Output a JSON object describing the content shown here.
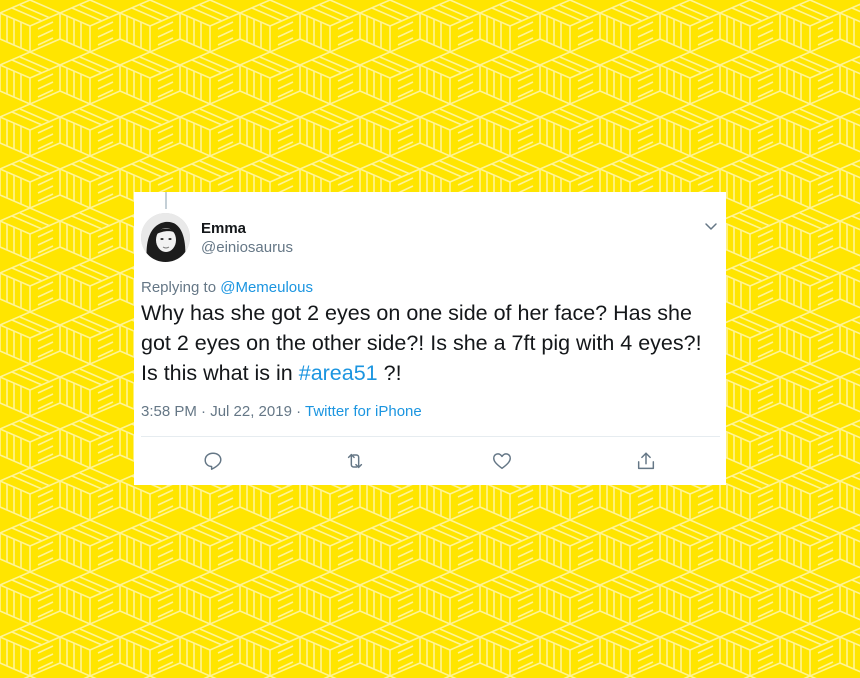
{
  "colors": {
    "background": "#ffe500",
    "pattern_line": "#fff7b0",
    "card": "#ffffff",
    "text": "#14171a",
    "secondary": "#657786",
    "link": "#1b95e0"
  },
  "tweet": {
    "author_name": "Emma",
    "author_handle": "@einiosaurus",
    "replying_prefix": "Replying to",
    "replying_to": "@Memeulous",
    "text_before_hashtag": "Why has she got 2 eyes on one side of her face? Has she got 2 eyes on the other side?! Is she a 7ft pig with 4 eyes?! Is this what is in ",
    "hashtag": "#area51",
    "text_after_hashtag": " ?!",
    "timestamp": "3:58 PM · Jul 22, 2019 ·",
    "source": "Twitter for iPhone"
  },
  "icons": {
    "menu": "chevron-down-icon",
    "reply": "reply-icon",
    "retweet": "retweet-icon",
    "like": "heart-icon",
    "share": "share-icon",
    "avatar": "avatar-photo"
  }
}
